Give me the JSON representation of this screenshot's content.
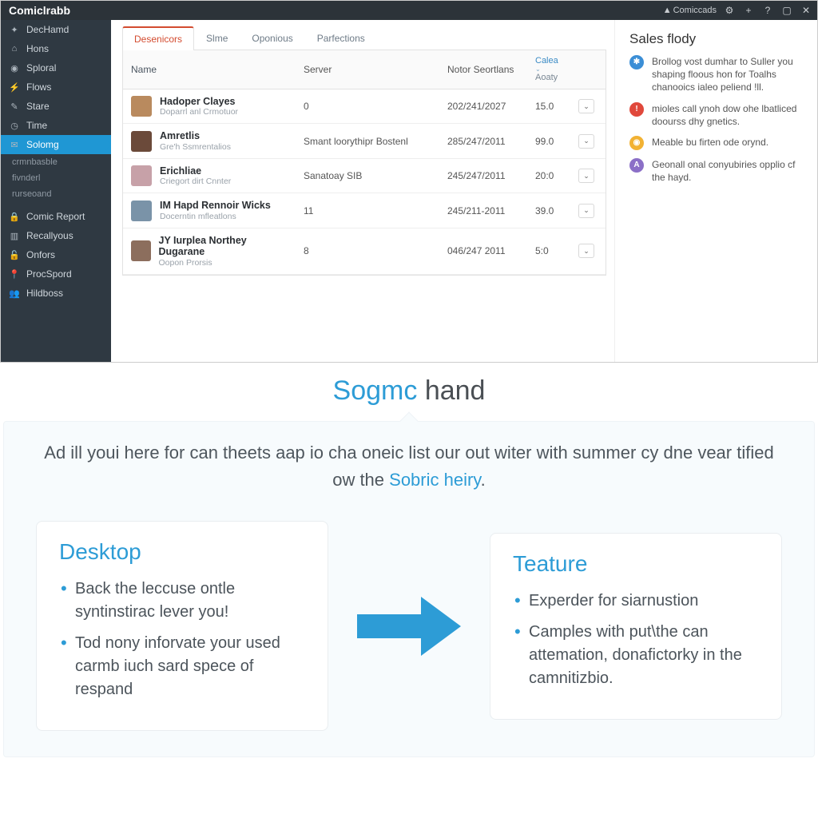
{
  "titlebar": {
    "brand": "Comiclrabb",
    "account": "Comiccads"
  },
  "sidebar": {
    "items": [
      {
        "icon": "dash",
        "label": "DecHamd"
      },
      {
        "icon": "home",
        "label": "Hons"
      },
      {
        "icon": "circle",
        "label": "Sploral"
      },
      {
        "icon": "bolt",
        "label": "Flows"
      },
      {
        "icon": "pencil",
        "label": "Stare"
      },
      {
        "icon": "clock",
        "label": "Time"
      },
      {
        "icon": "mail",
        "label": "Solomg",
        "active": true
      }
    ],
    "sub": [
      "crmnbasble",
      "fivnderl",
      "rurseoand"
    ],
    "items2": [
      {
        "icon": "lock",
        "label": "Comic Report"
      },
      {
        "icon": "bars",
        "label": "Recallyous"
      },
      {
        "icon": "unlock",
        "label": "Onfors"
      },
      {
        "icon": "pin",
        "label": "ProcSpord"
      },
      {
        "icon": "users",
        "label": "Hildboss"
      }
    ]
  },
  "tabs": [
    "Desenicors",
    "Slme",
    "Oponious",
    "Parfections"
  ],
  "columns": {
    "name": "Name",
    "server": "Server",
    "notor": "Notor Seortlans",
    "caloa1": "Calea",
    "caloa2": "Aoaty"
  },
  "rows": [
    {
      "name": "Hadoper Clayes",
      "sub": "Doparrl anl Crmotuor",
      "server": "0",
      "notor": "202/241/2027",
      "cal": "15.0",
      "av": "#b98a5e"
    },
    {
      "name": "Amretlis",
      "sub": "Gre'h Ssmrentalios",
      "server": "Smant loorythipr Bostenl",
      "notor": "285/247/2011",
      "cal": "99.0",
      "av": "#6b4a3a"
    },
    {
      "name": "Erichliae",
      "sub": "Criegort dirt Cnnter",
      "server": "Sanatoay SIB",
      "notor": "245/247/2011",
      "cal": "20:0",
      "av": "#c7a1a8"
    },
    {
      "name": "IM Hapd Rennoir Wicks",
      "sub": "Docerntin mfleatlons",
      "server": "11",
      "notor": "245/211-2011",
      "cal": "39.0",
      "av": "#7a93a8"
    },
    {
      "name": "JY Iurplea Northey Dugarane",
      "sub": "Oopon Prorsis",
      "server": "8",
      "notor": "046/247 2011",
      "cal": "5:0",
      "av": "#8c6e5d"
    }
  ],
  "sidepanel": {
    "title": "Sales flody",
    "items": [
      {
        "color": "#3b8ed6",
        "glyph": "✱",
        "text": "Brollog vost dumhar to Suller you shaping floous hon for Toalhs chanooics ialeo peliend !ll."
      },
      {
        "color": "#e0483b",
        "glyph": "!",
        "text": "mioles call ynoh dow ohe lbatliced doourss dhy gnetics."
      },
      {
        "color": "#f2b233",
        "glyph": "◉",
        "text": "Meable bu firten ode orynd."
      },
      {
        "color": "#8b6fc7",
        "glyph": "A",
        "text": "Geonall onal conyubiries opplio cf the hayd."
      }
    ]
  },
  "marketing": {
    "title_accent": "Sogmc",
    "title_rest": "hand",
    "lead_a": "Ad ill youi here for can theets aap io cha oneic list our out witer with summer cy dne vear tified ow the ",
    "lead_link": "Sobric heiry",
    "lead_b": ".",
    "cards": [
      {
        "title": "Desktop",
        "bullets": [
          "Back the leccuse ontle syntinstirac lever you!",
          "Tod nony inforvate your used carmb iuch sard spece of respand"
        ]
      },
      {
        "title": "Teature",
        "bullets": [
          "Experder for siarnustion",
          "Camples with put\\the can attemation, donafictorky in the camnitizbio."
        ]
      }
    ]
  }
}
